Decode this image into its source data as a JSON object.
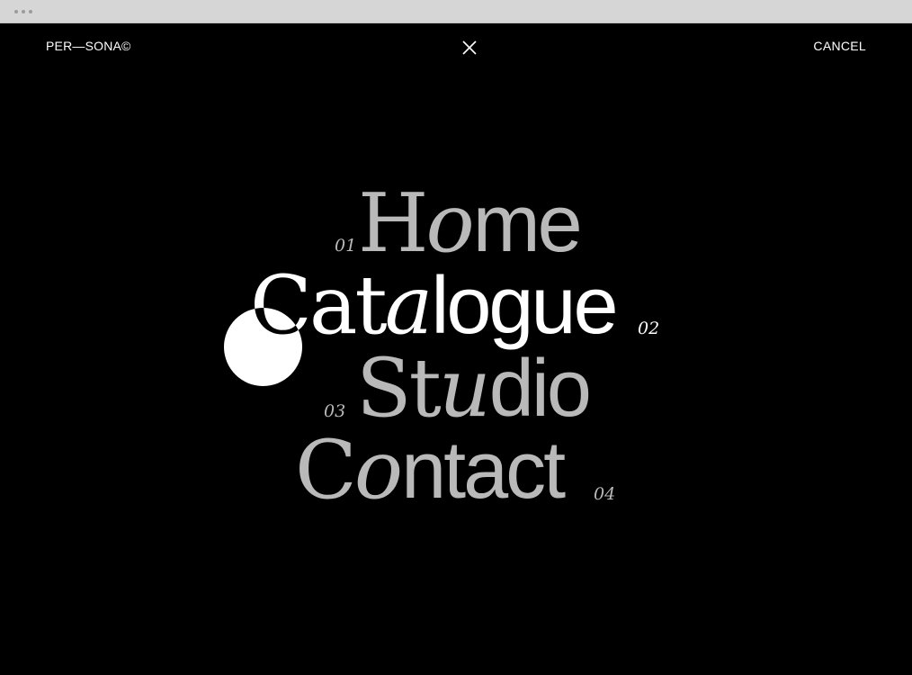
{
  "header": {
    "brand": "PER—SONA©",
    "cancel_label": "CANCEL",
    "close_icon": "close-icon"
  },
  "menu": {
    "items": [
      {
        "number": "01",
        "label": "Home",
        "parts": [
          "H",
          "o",
          "me"
        ],
        "active": false
      },
      {
        "number": "02",
        "label": "Catalogue",
        "parts": [
          "Cat",
          "a",
          "logue"
        ],
        "active": true
      },
      {
        "number": "03",
        "label": "Studio",
        "parts": [
          "St",
          "u",
          "dio"
        ],
        "active": false
      },
      {
        "number": "04",
        "label": "Contact",
        "parts": [
          "C",
          "o",
          "ntact"
        ],
        "active": false
      }
    ]
  },
  "colors": {
    "background": "#000000",
    "inactive_item": "#b9b9b9",
    "active_item": "#ffffff"
  }
}
